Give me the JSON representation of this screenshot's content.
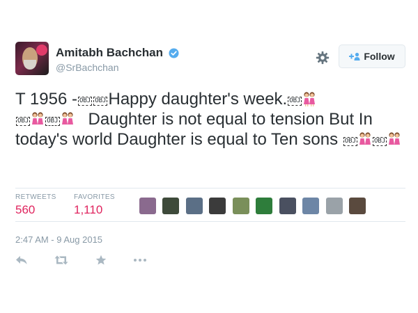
{
  "user": {
    "name": "Amitabh Bachchan",
    "handle": "@SrBachchan"
  },
  "buttons": {
    "follow_label": "Follow"
  },
  "tweet": {
    "prefix": "T 1956 -",
    "part1": "Happy  daughter's week.",
    "part2": "Daughter is not equal to tension But In today's world Daughter is equal to Ten sons",
    "obj_glyph": "OBJ"
  },
  "stats": {
    "retweets_label": "RETWEETS",
    "retweets_value": "560",
    "favorites_label": "FAVORITES",
    "favorites_value": "1,110"
  },
  "timestamp": "2:47 AM - 9 Aug 2015",
  "colors": {
    "accent": "#55acee",
    "count": "#e0245e",
    "muted": "#8899a6",
    "border": "#e1e8ed"
  },
  "icons": [
    "verified-icon",
    "gear-icon",
    "follow-person-icon",
    "girls-emoji-icon",
    "reply-icon",
    "retweet-icon",
    "favorite-icon",
    "more-icon"
  ]
}
